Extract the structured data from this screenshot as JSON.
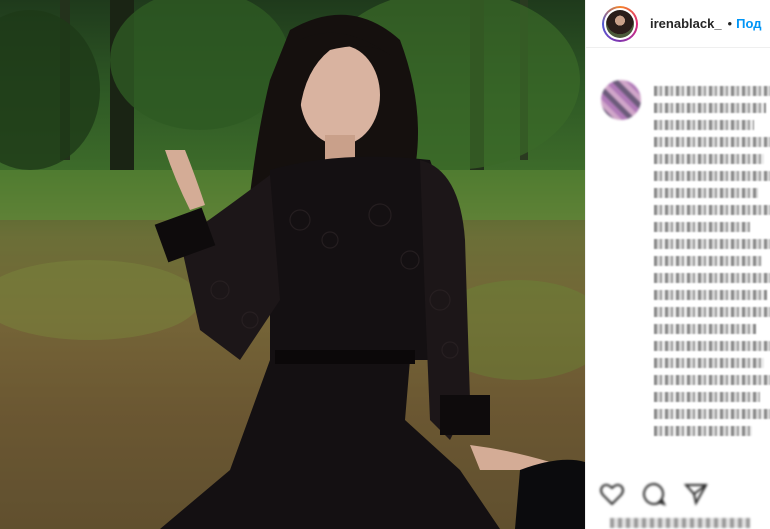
{
  "post": {
    "username": "irenablack_",
    "separator": "•",
    "follow_label": "Под",
    "photo_description": ""
  },
  "caption": {
    "lines": [
      "",
      "",
      "",
      "",
      "",
      "",
      "",
      "",
      "",
      "",
      "",
      "",
      "",
      "",
      "",
      "",
      "",
      "",
      "",
      "",
      "",
      ""
    ]
  },
  "actions": {
    "like_icon": "heart-icon",
    "comment_icon": "comment-icon",
    "share_icon": "share-icon"
  },
  "colors": {
    "follow": "#0095f6",
    "text": "#262626",
    "border": "#efefef"
  }
}
